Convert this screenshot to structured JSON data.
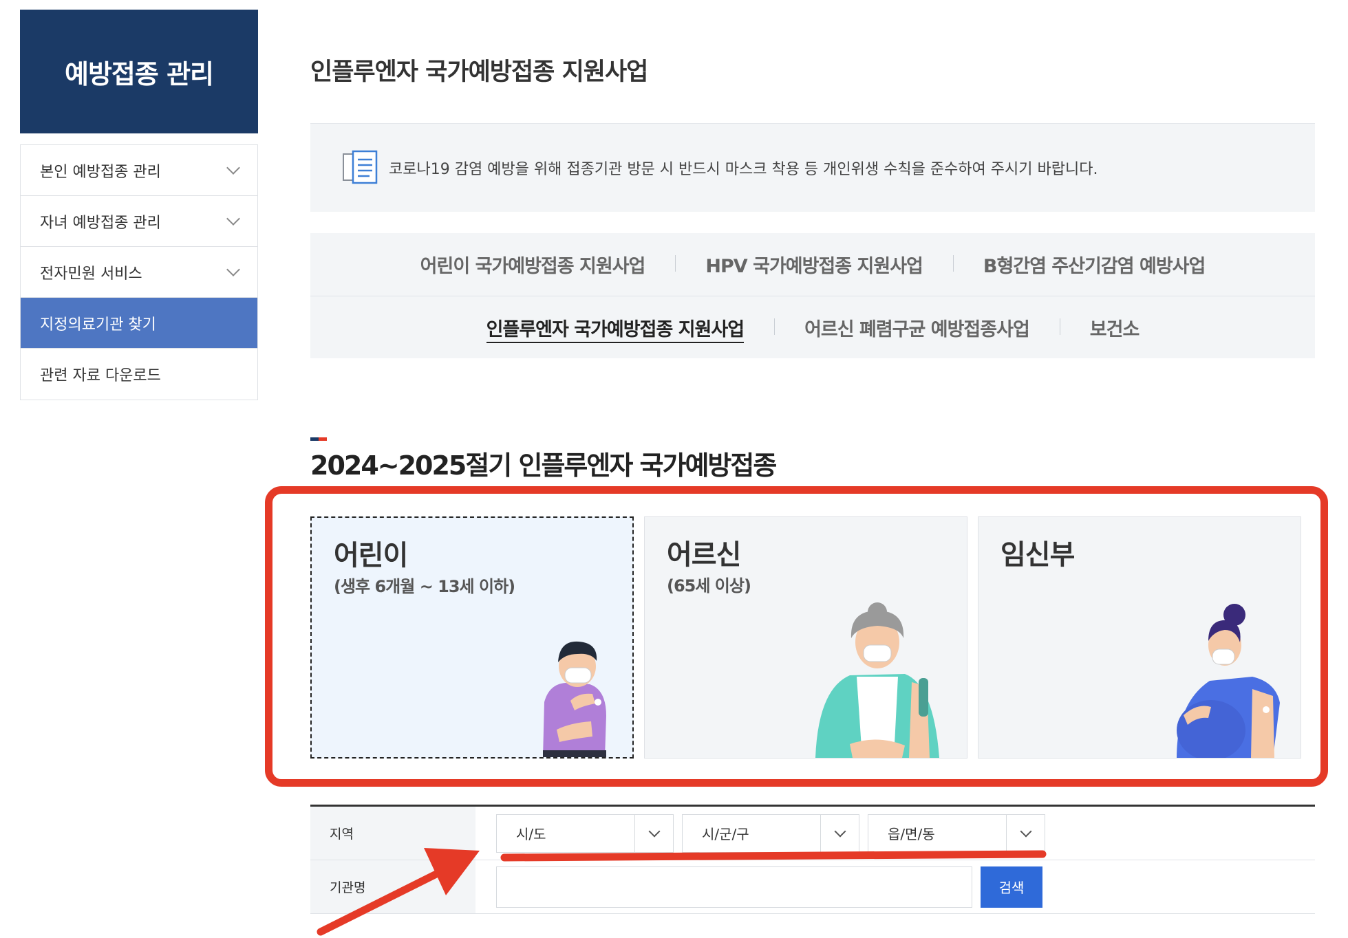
{
  "sidebar": {
    "title": "예방접종 관리",
    "items": [
      {
        "label": "본인 예방접종 관리",
        "has_chevron": true
      },
      {
        "label": "자녀 예방접종 관리",
        "has_chevron": true
      },
      {
        "label": "전자민원 서비스",
        "has_chevron": true
      },
      {
        "label": "지정의료기관 찾기",
        "active": true
      },
      {
        "label": "관련 자료 다운로드"
      }
    ]
  },
  "page": {
    "title": "인플루엔자 국가예방접종 지원사업",
    "notice": "코로나19 감염 예방을 위해 접종기관 방문 시 반드시 마스크 착용 등 개인위생 수칙을 준수하여 주시기 바랍니다.",
    "notice_icon": "document-list-icon"
  },
  "tabs": {
    "row1": [
      "어린이 국가예방접종 지원사업",
      "HPV 국가예방접종 지원사업",
      "B형간염 주산기감염 예방사업"
    ],
    "row2": [
      "인플루엔자 국가예방접종 지원사업",
      "어르신 폐렴구균 예방접종사업",
      "보건소"
    ],
    "active": "인플루엔자 국가예방접종 지원사업"
  },
  "section": {
    "title": "2024~2025절기 인플루엔자 국가예방접종",
    "bar_colors": [
      "#1b3a66",
      "#e53a27"
    ]
  },
  "cards": [
    {
      "title": "어린이",
      "subtitle": "(생후 6개월 ~ 13세 이하)",
      "selected": true
    },
    {
      "title": "어르신",
      "subtitle": "(65세 이상)"
    },
    {
      "title": "임신부",
      "subtitle": ""
    }
  ],
  "form": {
    "region_label": "지역",
    "selects": [
      "시/도",
      "시/군/구",
      "읍/면/동"
    ],
    "name_label": "기관명",
    "name_value": "",
    "search_label": "검색"
  },
  "colors": {
    "annotation_red": "#e53a27",
    "sidebar_navy": "#1b3a66",
    "active_blue": "#4e76c2",
    "button_blue": "#2f6ad9"
  }
}
